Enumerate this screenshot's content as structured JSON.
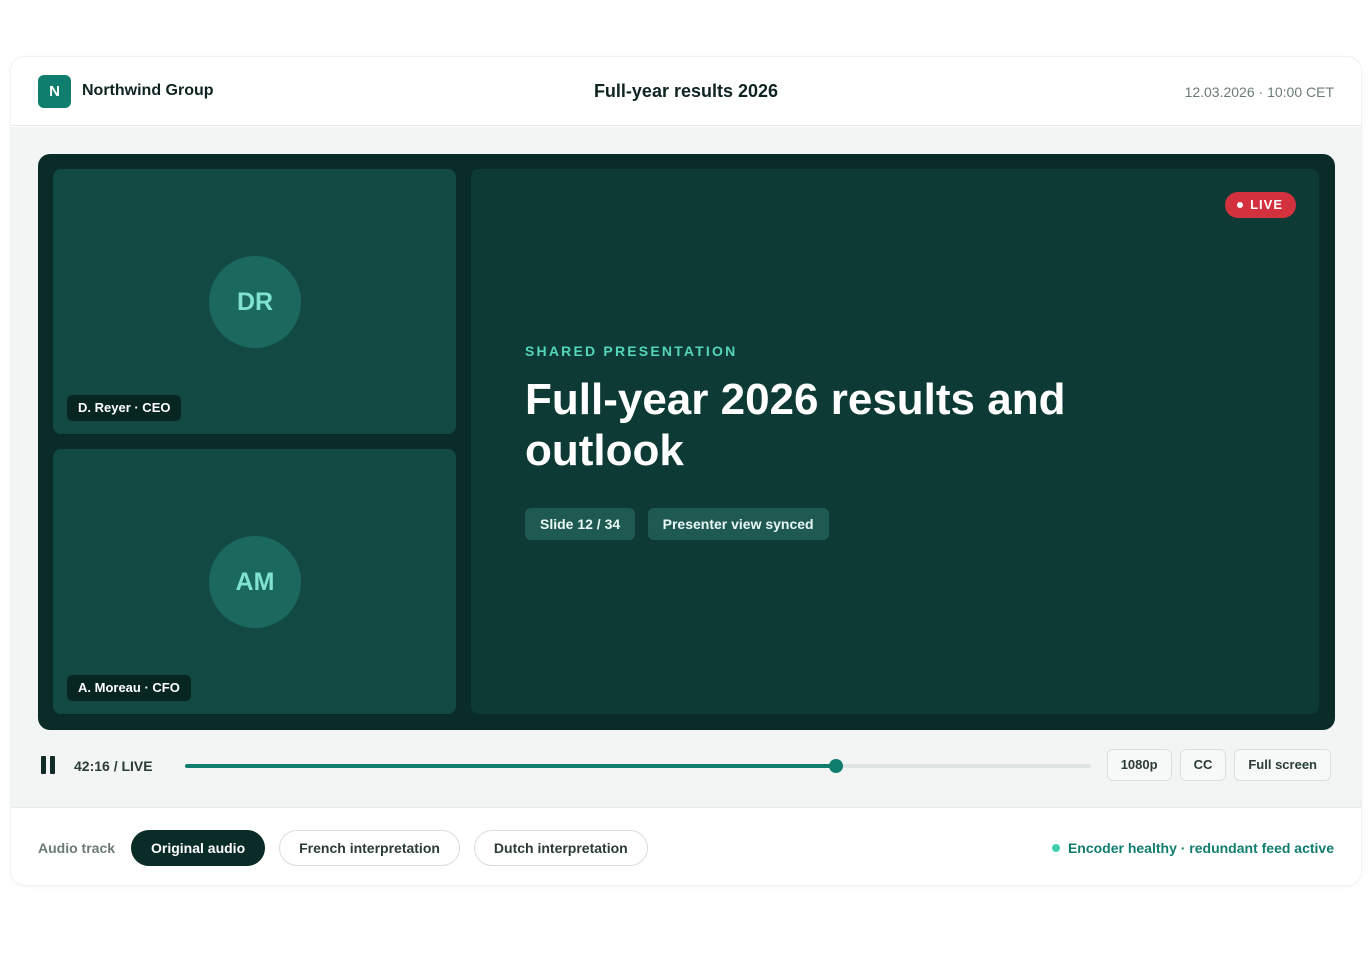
{
  "header": {
    "logo_letter": "N",
    "company": "Northwind Group",
    "event_title": "Full-year results 2026",
    "datetime": "12.03.2026 · 10:00 CET"
  },
  "speakers": [
    {
      "initials": "DR",
      "label": "D. Reyer · CEO"
    },
    {
      "initials": "AM",
      "label": "A. Moreau · CFO"
    }
  ],
  "slide": {
    "live_label": "LIVE",
    "kicker": "SHARED PRESENTATION",
    "title": "Full-year 2026 results and outlook",
    "slide_counter": "Slide 12 / 34",
    "sync_status": "Presenter view synced"
  },
  "controls": {
    "pause_icon": "pause-icon",
    "time": "42:16 / LIVE",
    "progress_fraction": 0.718,
    "quality": "1080p",
    "captions": "CC",
    "fullscreen": "Full screen"
  },
  "audio": {
    "label": "Audio track",
    "options": [
      "Original audio",
      "French interpretation",
      "Dutch interpretation"
    ],
    "selected": "Original audio",
    "health_status": "Encoder healthy · redundant feed active"
  },
  "colors": {
    "accent": "#0f7e6e",
    "player_bg": "#0a2c28",
    "tile_bg": "#124a43",
    "live_red": "#d2313d",
    "kicker_teal": "#54d6bb",
    "health_dot": "#3fcfae"
  }
}
